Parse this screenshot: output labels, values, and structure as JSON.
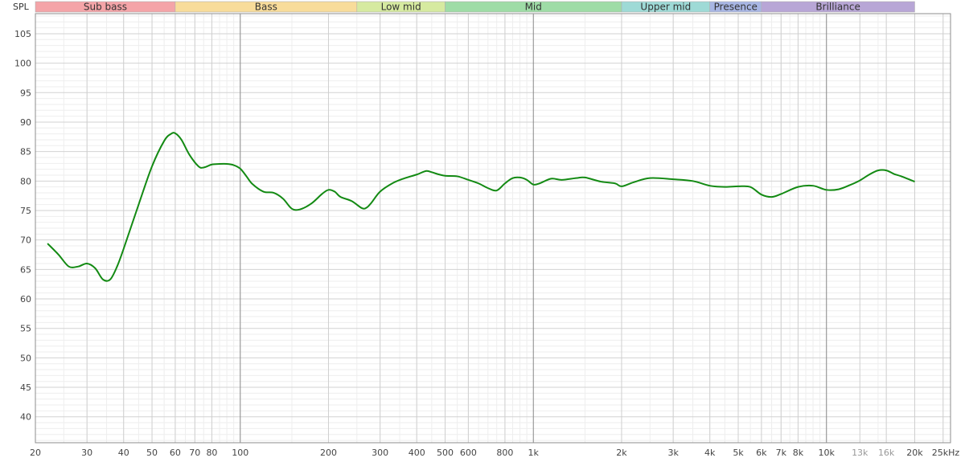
{
  "chart_data": {
    "type": "line",
    "title": "",
    "ylabel": "SPL",
    "xlabel": "",
    "x_scale": "log",
    "xlim": [
      20,
      26500
    ],
    "ylim": [
      35.6,
      108.4
    ],
    "grid": true,
    "bands": [
      {
        "name": "Sub bass",
        "from": 20,
        "to": 60,
        "color": "#f4a4a8"
      },
      {
        "name": "Bass",
        "from": 60,
        "to": 250,
        "color": "#f8dc9a"
      },
      {
        "name": "Low mid",
        "from": 250,
        "to": 500,
        "color": "#d6eaa0"
      },
      {
        "name": "Mid",
        "from": 500,
        "to": 2000,
        "color": "#9edca6"
      },
      {
        "name": "Upper mid",
        "from": 2000,
        "to": 4000,
        "color": "#9edad6"
      },
      {
        "name": "Presence",
        "from": 4000,
        "to": 6000,
        "color": "#a8b6e4"
      },
      {
        "name": "Brilliance",
        "from": 6000,
        "to": 20000,
        "color": "#b8a6d6"
      }
    ],
    "y_ticks": [
      40,
      45,
      50,
      55,
      60,
      65,
      70,
      75,
      80,
      85,
      90,
      95,
      100,
      105
    ],
    "x_ticks": [
      {
        "value": 20,
        "label": "20"
      },
      {
        "value": 30,
        "label": "30"
      },
      {
        "value": 40,
        "label": "40"
      },
      {
        "value": 50,
        "label": "50"
      },
      {
        "value": 60,
        "label": "60"
      },
      {
        "value": 70,
        "label": "70"
      },
      {
        "value": 80,
        "label": "80"
      },
      {
        "value": 100,
        "label": "100"
      },
      {
        "value": 200,
        "label": "200"
      },
      {
        "value": 300,
        "label": "300"
      },
      {
        "value": 400,
        "label": "400"
      },
      {
        "value": 500,
        "label": "500"
      },
      {
        "value": 600,
        "label": "600"
      },
      {
        "value": 800,
        "label": "800"
      },
      {
        "value": 1000,
        "label": "1k"
      },
      {
        "value": 2000,
        "label": "2k"
      },
      {
        "value": 3000,
        "label": "3k"
      },
      {
        "value": 4000,
        "label": "4k"
      },
      {
        "value": 5000,
        "label": "5k"
      },
      {
        "value": 6000,
        "label": "6k"
      },
      {
        "value": 7000,
        "label": "7k"
      },
      {
        "value": 8000,
        "label": "8k"
      },
      {
        "value": 10000,
        "label": "10k"
      },
      {
        "value": 13000,
        "label": "13k",
        "dim": true
      },
      {
        "value": 16000,
        "label": "16k",
        "dim": true
      },
      {
        "value": 20000,
        "label": "20k"
      },
      {
        "value": 25000,
        "label": "25kHz"
      }
    ],
    "series": [
      {
        "color": "#138a13",
        "x": [
          22,
          24,
          26,
          28,
          30,
          32,
          34,
          36,
          38,
          40,
          45,
          50,
          55,
          58,
          60,
          63,
          67,
          72,
          75,
          80,
          85,
          90,
          95,
          100,
          105,
          110,
          120,
          130,
          140,
          150,
          160,
          175,
          190,
          200,
          210,
          220,
          240,
          260,
          270,
          280,
          300,
          330,
          360,
          400,
          430,
          450,
          470,
          500,
          550,
          600,
          650,
          700,
          750,
          800,
          850,
          900,
          950,
          1000,
          1050,
          1150,
          1250,
          1400,
          1500,
          1700,
          1900,
          2000,
          2200,
          2500,
          3000,
          3500,
          4000,
          4500,
          5000,
          5500,
          6000,
          6500,
          7000,
          8000,
          9000,
          10000,
          11000,
          12000,
          13000,
          14000,
          15000,
          16000,
          17000,
          18000,
          20000
        ],
        "y": [
          69.4,
          67.5,
          65.5,
          65.5,
          66.0,
          65.2,
          63.3,
          63.3,
          65.5,
          68.5,
          76.0,
          82.5,
          86.8,
          88.0,
          88.1,
          87.0,
          84.5,
          82.5,
          82.3,
          82.8,
          82.9,
          82.9,
          82.7,
          82.1,
          80.8,
          79.5,
          78.2,
          78.0,
          77.0,
          75.3,
          75.2,
          76.2,
          77.8,
          78.5,
          78.2,
          77.3,
          76.6,
          75.4,
          75.5,
          76.3,
          78.2,
          79.6,
          80.4,
          81.1,
          81.7,
          81.5,
          81.2,
          80.9,
          80.8,
          80.2,
          79.6,
          78.8,
          78.4,
          79.6,
          80.5,
          80.6,
          80.2,
          79.4,
          79.6,
          80.4,
          80.2,
          80.5,
          80.6,
          79.9,
          79.6,
          79.1,
          79.8,
          80.5,
          80.3,
          80.0,
          79.2,
          79.0,
          79.1,
          79.0,
          77.7,
          77.3,
          77.8,
          79.0,
          79.2,
          78.5,
          78.6,
          79.3,
          80.1,
          81.1,
          81.8,
          81.8,
          81.2,
          80.8,
          79.9
        ]
      }
    ]
  }
}
